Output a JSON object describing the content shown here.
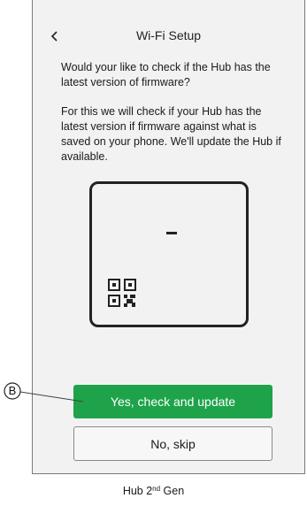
{
  "screen": {
    "title": "Wi-Fi Setup",
    "back_icon": "chevron-left-icon",
    "question": "Would your like to check if the Hub has the latest version of firmware?",
    "description": "For this we will check if your Hub has the latest version if firmware against what is saved on your phone. We'll update the Hub if available.",
    "device_illustration": "hub-device-icon",
    "primary_button": "Yes, check and update",
    "secondary_button": "No, skip",
    "primary_color": "#1ea34a"
  },
  "callout": {
    "letter": "B"
  },
  "caption": {
    "prefix": "Hub 2",
    "superscript": "nd",
    "suffix": " Gen"
  }
}
